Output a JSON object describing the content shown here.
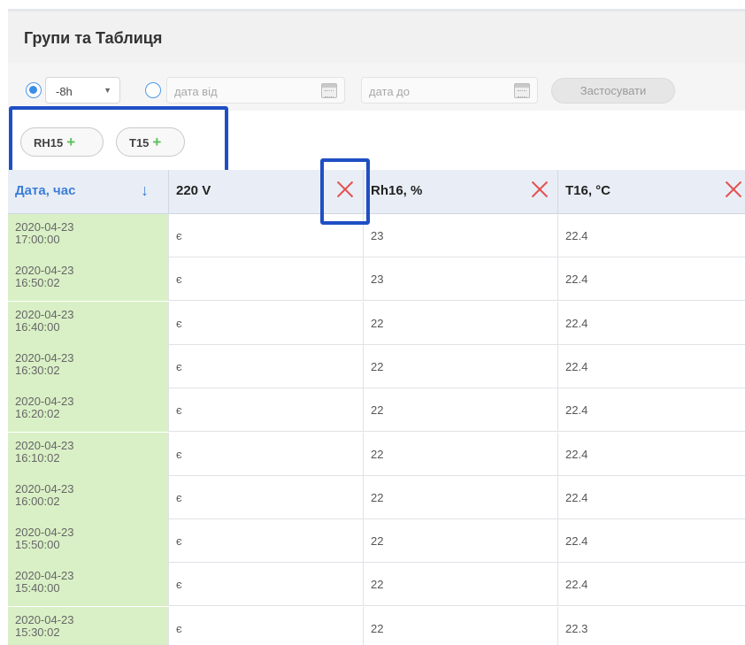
{
  "header": {
    "title": "Групи та Таблиця"
  },
  "filters": {
    "range_value": "-8h",
    "date_from_placeholder": "дата від",
    "date_to_placeholder": "дата до",
    "apply_label": "Застосувати"
  },
  "tags": [
    {
      "label": "RH15"
    },
    {
      "label": "T15"
    }
  ],
  "table": {
    "columns": [
      "Дата, час",
      "220 V",
      "Rh16, %",
      "T16, °C"
    ],
    "rows": [
      {
        "date": "2020-04-23",
        "time": "17:00:00",
        "v220": "є",
        "rh16": "23",
        "t16": "22.4"
      },
      {
        "date": "2020-04-23",
        "time": "16:50:02",
        "v220": "є",
        "rh16": "23",
        "t16": "22.4"
      },
      {
        "date": "2020-04-23",
        "time": "16:40:00",
        "v220": "є",
        "rh16": "22",
        "t16": "22.4"
      },
      {
        "date": "2020-04-23",
        "time": "16:30:02",
        "v220": "є",
        "rh16": "22",
        "t16": "22.4"
      },
      {
        "date": "2020-04-23",
        "time": "16:20:02",
        "v220": "є",
        "rh16": "22",
        "t16": "22.4"
      },
      {
        "date": "2020-04-23",
        "time": "16:10:02",
        "v220": "є",
        "rh16": "22",
        "t16": "22.4"
      },
      {
        "date": "2020-04-23",
        "time": "16:00:02",
        "v220": "є",
        "rh16": "22",
        "t16": "22.4"
      },
      {
        "date": "2020-04-23",
        "time": "15:50:00",
        "v220": "є",
        "rh16": "22",
        "t16": "22.4"
      },
      {
        "date": "2020-04-23",
        "time": "15:40:00",
        "v220": "є",
        "rh16": "22",
        "t16": "22.4"
      },
      {
        "date": "2020-04-23",
        "time": "15:30:02",
        "v220": "є",
        "rh16": "22",
        "t16": "22.3"
      }
    ]
  },
  "colors": {
    "accent": "#3c7ed8",
    "date_cell_bg": "#d9f0c6",
    "remove_icon": "#e35151",
    "highlight_box": "#1f4fc4",
    "add_icon": "#5cc25c"
  },
  "icons": {
    "sort": "arrow-down-icon",
    "remove_column": "close-icon",
    "calendar": "calendar-icon",
    "add_tag": "plus-icon"
  }
}
